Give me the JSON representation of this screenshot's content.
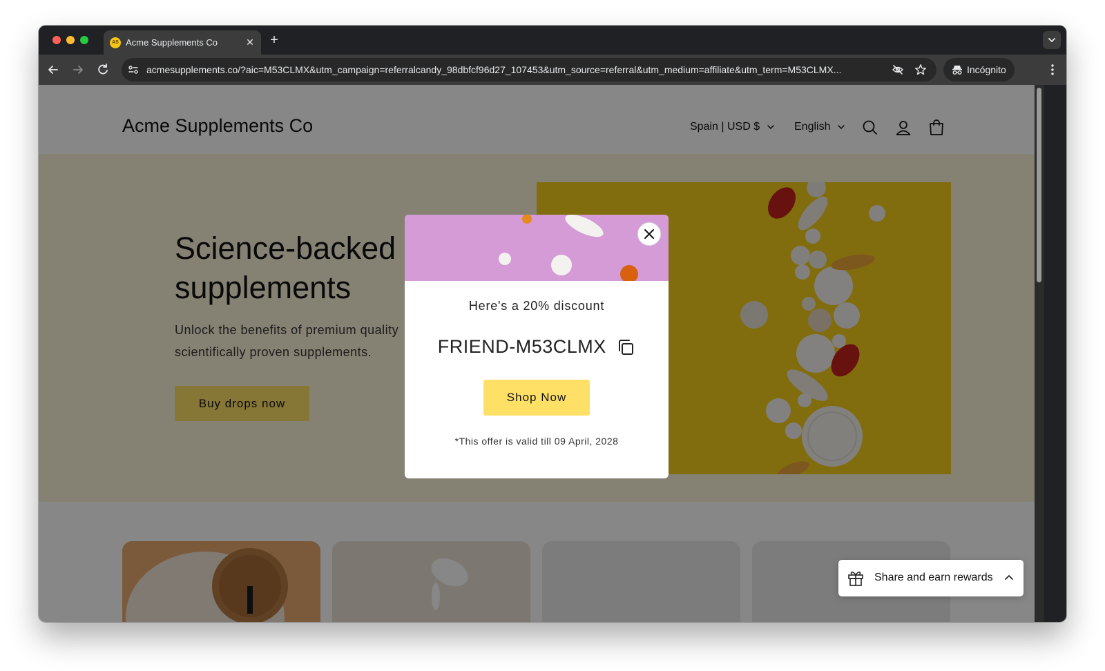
{
  "browser": {
    "tab_title": "Acme Supplements Co",
    "favicon_text": "AS",
    "url": "acmesupplements.co/?aic=M53CLMX&utm_campaign=referralcandy_98dbfcf96d27_107453&utm_source=referral&utm_medium=affiliate&utm_term=M53CLMX...",
    "incognito_label": "Incógnito"
  },
  "store": {
    "logo": "Acme Supplements Co",
    "locale_selector": "Spain | USD $",
    "language_selector": "English"
  },
  "hero": {
    "title": "Science-backed supplements",
    "text": "Unlock the benefits of premium quality scientifically proven supplements.",
    "button_label": "Buy drops now"
  },
  "modal": {
    "heading": "Here's a 20% discount",
    "code": "FRIEND-M53CLMX",
    "button_label": "Shop Now",
    "note": "*This offer is valid till 09 April, 2028"
  },
  "share_widget": {
    "label": "Share and earn rewards"
  },
  "colors": {
    "accent_yellow": "#ffe066",
    "hero_bg": "#fcf5dc",
    "banner_purple": "#d49bd6",
    "image_yellow": "#f4cd1b"
  },
  "icons": [
    "back-arrow-icon",
    "forward-arrow-icon",
    "reload-icon",
    "site-info-icon",
    "eye-off-icon",
    "star-icon",
    "incognito-icon",
    "more-vert-icon",
    "search-icon",
    "account-icon",
    "cart-icon",
    "close-icon",
    "copy-icon",
    "gift-icon",
    "chevron-up-icon",
    "chevron-down-icon"
  ]
}
